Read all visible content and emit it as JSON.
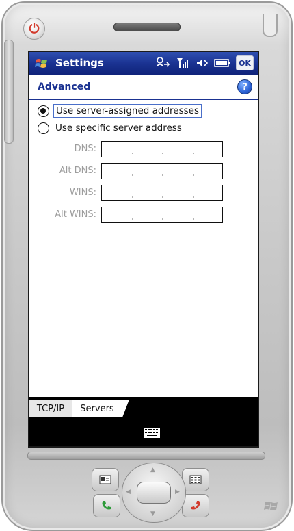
{
  "titlebar": {
    "app_title": "Settings",
    "ok_label": "OK",
    "icons": [
      "windows-flag-icon",
      "connectivity-icon",
      "signal-icon",
      "volume-icon",
      "battery-icon"
    ]
  },
  "header": {
    "title": "Advanced",
    "help_icon_label": "?"
  },
  "options": {
    "server_assigned": "Use server-assigned addresses",
    "specific": "Use specific server address",
    "selected": "server_assigned"
  },
  "fields": [
    {
      "label": "DNS:",
      "value": "",
      "enabled": false
    },
    {
      "label": "Alt DNS:",
      "value": "",
      "enabled": false
    },
    {
      "label": "WINS:",
      "value": "",
      "enabled": false
    },
    {
      "label": "Alt WINS:",
      "value": "",
      "enabled": false
    }
  ],
  "tabs": [
    {
      "label": "TCP/IP",
      "active": false
    },
    {
      "label": "Servers",
      "active": true
    }
  ],
  "softkey_bar": {
    "icon": "keyboard-icon"
  },
  "colors": {
    "titlebar": "#1a3291",
    "header_text": "#1a3291",
    "power": "#d23a2c",
    "call_green": "#2e9b3a",
    "call_red": "#d23a2c"
  }
}
